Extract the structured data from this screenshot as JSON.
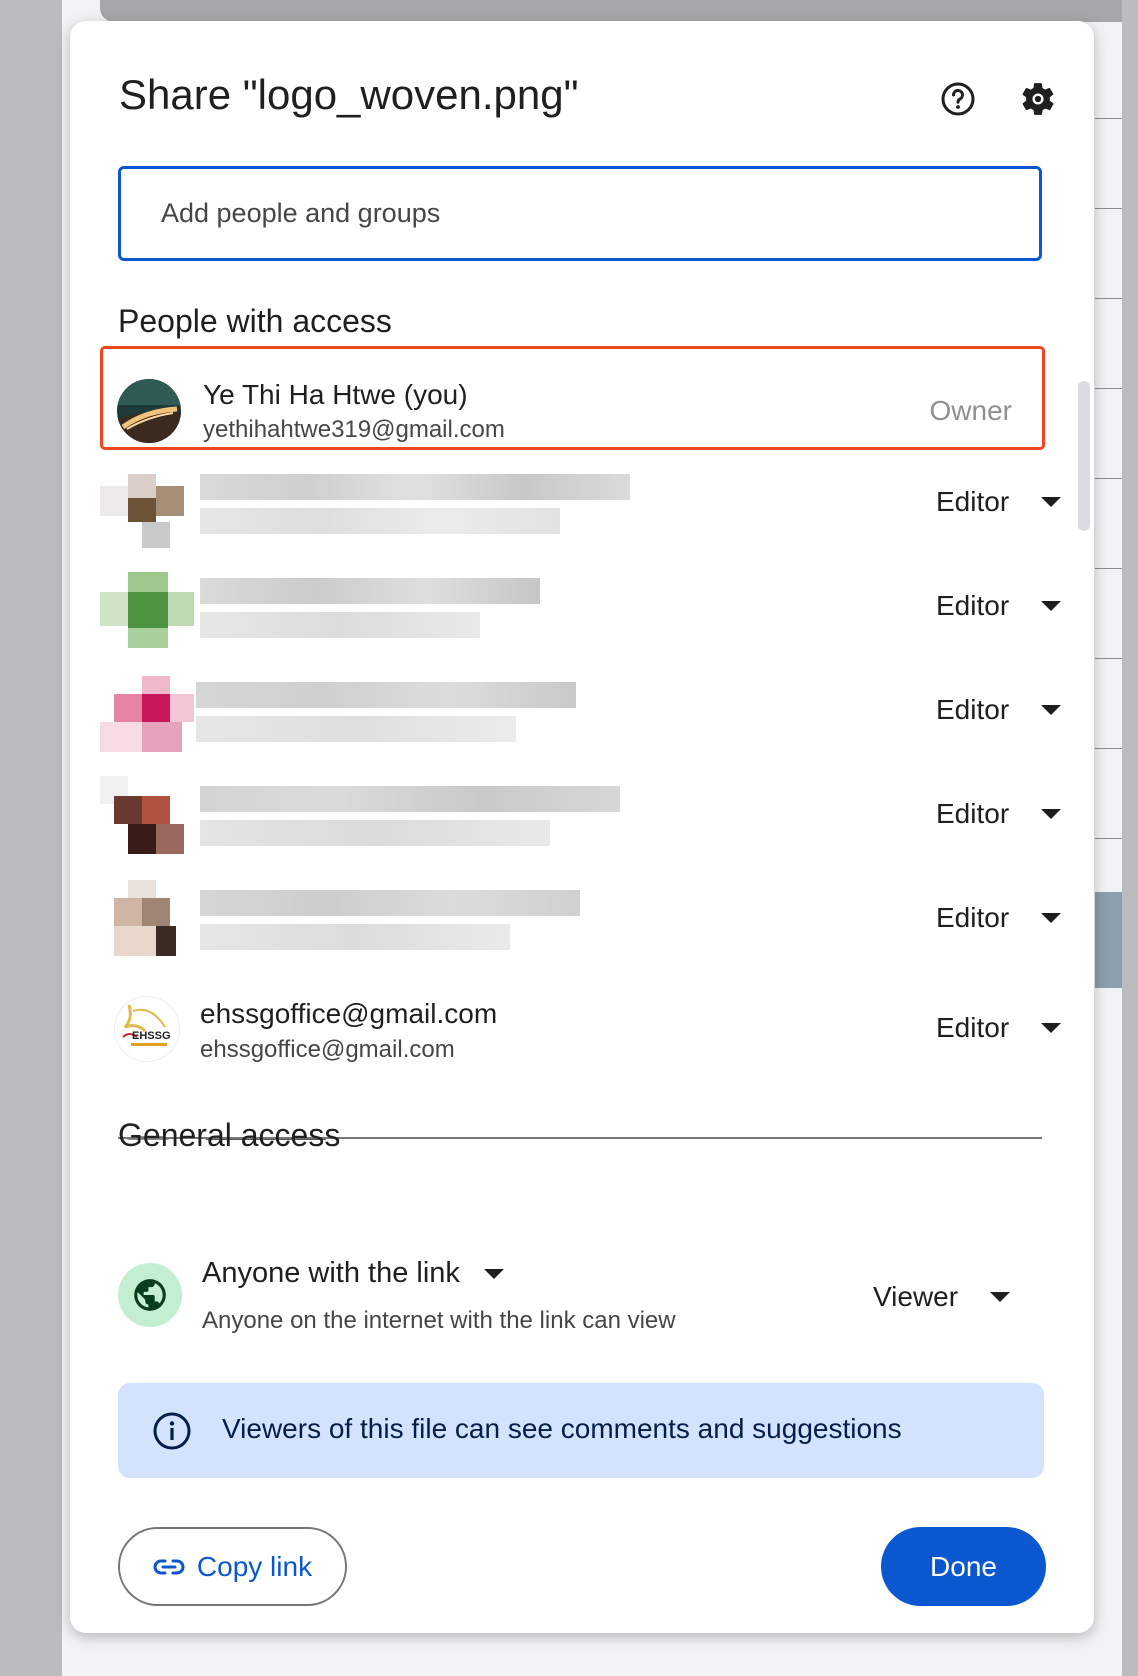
{
  "dialog": {
    "title": "Share \"logo_woven.png\"",
    "help_icon": "help-circle-icon",
    "settings_icon": "gear-icon"
  },
  "add_people": {
    "placeholder": "Add people and groups"
  },
  "people_section": {
    "heading": "People with access",
    "people": [
      {
        "name": "Ye Thi Ha Htwe (you)",
        "email": "yethihahtwe319@gmail.com",
        "role": "Owner"
      },
      {
        "name": "",
        "email": "",
        "role": "Editor",
        "blurred": true
      },
      {
        "name": "",
        "email": "",
        "role": "Editor",
        "blurred": true
      },
      {
        "name": "",
        "email": "",
        "role": "Editor",
        "blurred": true
      },
      {
        "name": "",
        "email": "",
        "role": "Editor",
        "blurred": true
      },
      {
        "name": "",
        "email": "",
        "role": "Editor",
        "blurred": true
      },
      {
        "name": "ehssgoffice@gmail.com",
        "email": "ehssgoffice@gmail.com",
        "role": "Editor",
        "avatar_text": "EHSSG"
      }
    ]
  },
  "general_access": {
    "heading": "General access",
    "link_setting": "Anyone with the link",
    "description": "Anyone on the internet with the link can view",
    "role": "Viewer",
    "icon": "globe-icon"
  },
  "info_banner": {
    "icon": "info-icon",
    "text": "Viewers of this file can see comments and suggestions"
  },
  "footer": {
    "copy_link_label": "Copy link",
    "copy_link_icon": "link-icon",
    "done_label": "Done"
  },
  "colors": {
    "accent": "#0b57d0",
    "highlight_border": "#f0451e",
    "banner_bg": "#d3e3fd",
    "globe_bg": "#c4eed0"
  }
}
